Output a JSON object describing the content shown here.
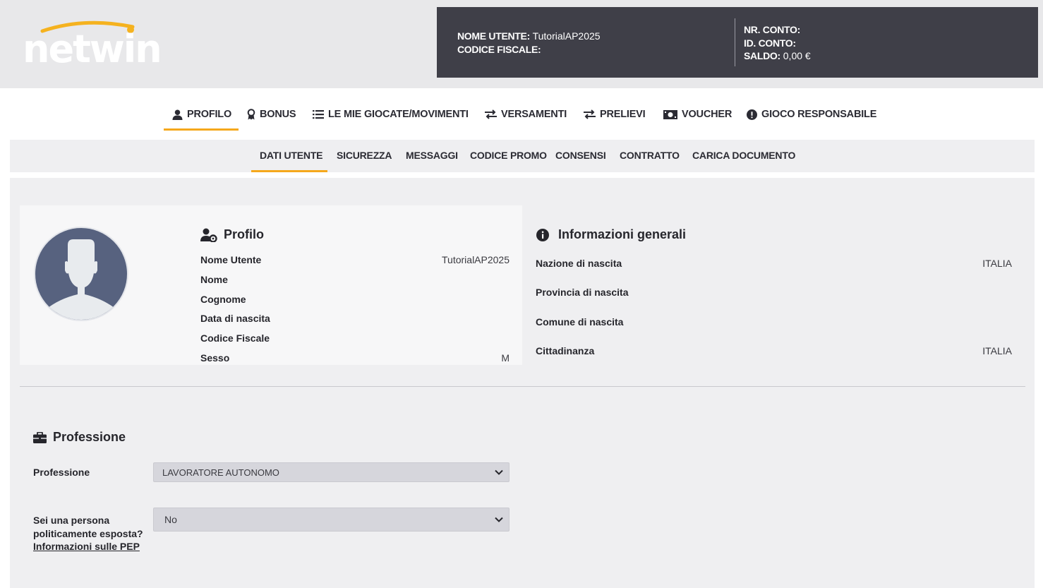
{
  "header": {
    "logo_text": "netwin",
    "account": {
      "username_label": "NOME UTENTE:",
      "username_value": "TutorialAP2025",
      "fiscal_code_label": "CODICE FISCALE:",
      "account_number_label": "NR. CONTO:",
      "account_id_label": "ID. CONTO:",
      "balance_label": "SALDO:",
      "balance_value": "0,00 €"
    }
  },
  "main_nav": {
    "items": [
      {
        "label": "PROFILO",
        "icon": "user-icon",
        "active": true
      },
      {
        "label": "BONUS",
        "icon": "award-icon"
      },
      {
        "label": "LE MIE GIOCATE/MOVIMENTI",
        "icon": "list-icon"
      },
      {
        "label": "VERSAMENTI",
        "icon": "exchange-icon"
      },
      {
        "label": "PRELIEVI",
        "icon": "exchange-icon"
      },
      {
        "label": "VOUCHER",
        "icon": "money-bill-icon"
      },
      {
        "label": "GIOCO RESPONSABILE",
        "icon": "exclamation-circle-icon"
      }
    ]
  },
  "sub_nav": {
    "items": [
      {
        "label": "DATI UTENTE",
        "active": true
      },
      {
        "label": "SICUREZZA"
      },
      {
        "label": "MESSAGGI"
      },
      {
        "label": "CODICE PROMO"
      },
      {
        "label": "CONSENSI"
      },
      {
        "label": "CONTRATTO"
      },
      {
        "label": "CARICA DOCUMENTO"
      }
    ]
  },
  "profile": {
    "title": "Profilo",
    "rows": [
      {
        "label": "Nome Utente",
        "value": "TutorialAP2025"
      },
      {
        "label": "Nome",
        "value": ""
      },
      {
        "label": "Cognome",
        "value": ""
      },
      {
        "label": "Data di nascita",
        "value": ""
      },
      {
        "label": "Codice Fiscale",
        "value": ""
      },
      {
        "label": "Sesso",
        "value": "M"
      }
    ]
  },
  "general_info": {
    "title": "Informazioni generali",
    "rows": [
      {
        "label": "Nazione di nascita",
        "value": "ITALIA"
      },
      {
        "label": "Provincia di nascita",
        "value": ""
      },
      {
        "label": "Comune di nascita",
        "value": ""
      },
      {
        "label": "Cittadinanza",
        "value": "ITALIA"
      }
    ]
  },
  "profession": {
    "title": "Professione",
    "field_label": "Professione",
    "selected": "LAVORATORE AUTONOMO",
    "pep_label_line1": "Sei una persona",
    "pep_label_line2": "politicamente esposta?",
    "pep_link": "Informazioni sulle PEP",
    "pep_selected": "No"
  },
  "colors": {
    "accent": "#f5a81c",
    "header_dark": "#3f3f48",
    "avatar_bg": "#57627f"
  }
}
